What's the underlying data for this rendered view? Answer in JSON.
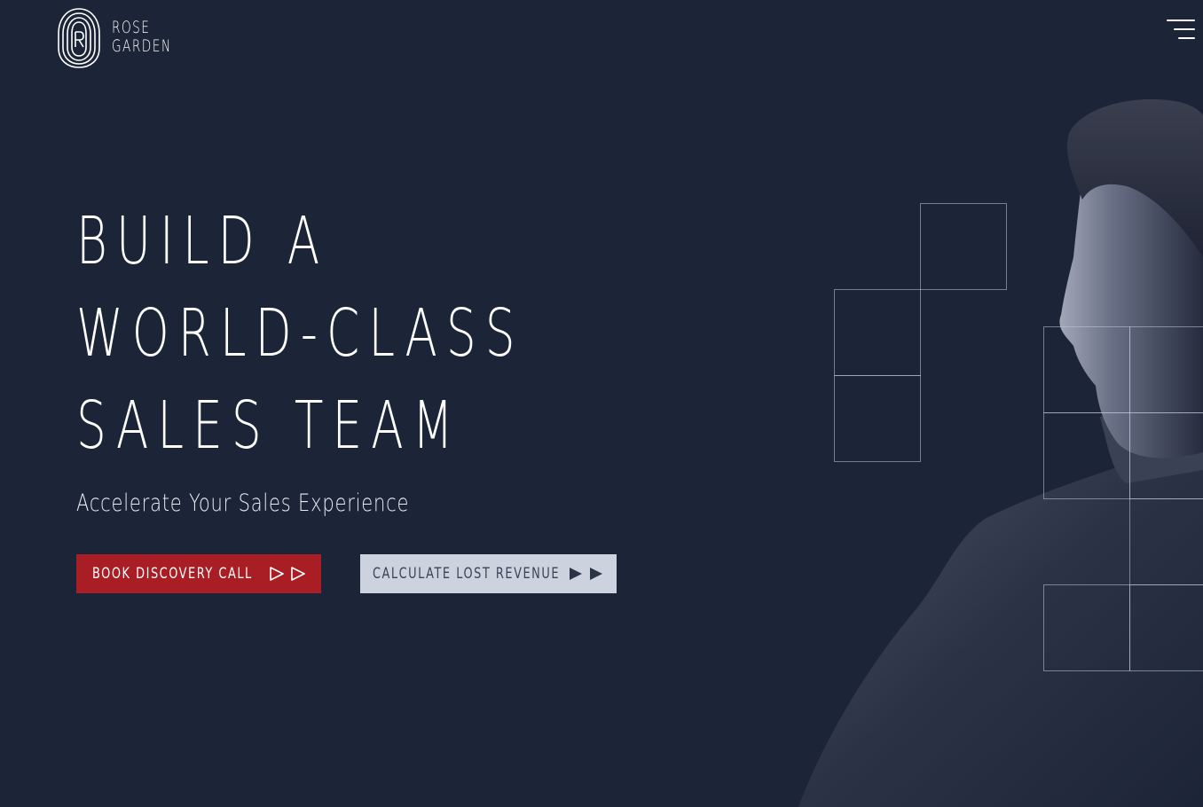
{
  "brand": {
    "name_line1": "ROSE",
    "name_line2": "GARDEN",
    "logo_icon": "fingerprint-r-icon"
  },
  "header": {
    "menu_icon": "hamburger-menu-icon"
  },
  "hero": {
    "title_lines": [
      "BUILD A",
      "WORLD-CLASS",
      "SALES TEAM"
    ],
    "subtitle": "Accelerate Your Sales Experience"
  },
  "buttons": {
    "primary": {
      "label": "BOOK DISCOVERY CALL",
      "icon": "double-outline-play-arrow-icon"
    },
    "secondary": {
      "label": "CALCULATE LOST REVENUE",
      "icon": "double-solid-play-arrow-icon"
    }
  },
  "colors": {
    "background": "#1c2437",
    "primary_button": "#a81e24",
    "secondary_button": "#ccd3df",
    "text": "#ffffff"
  }
}
